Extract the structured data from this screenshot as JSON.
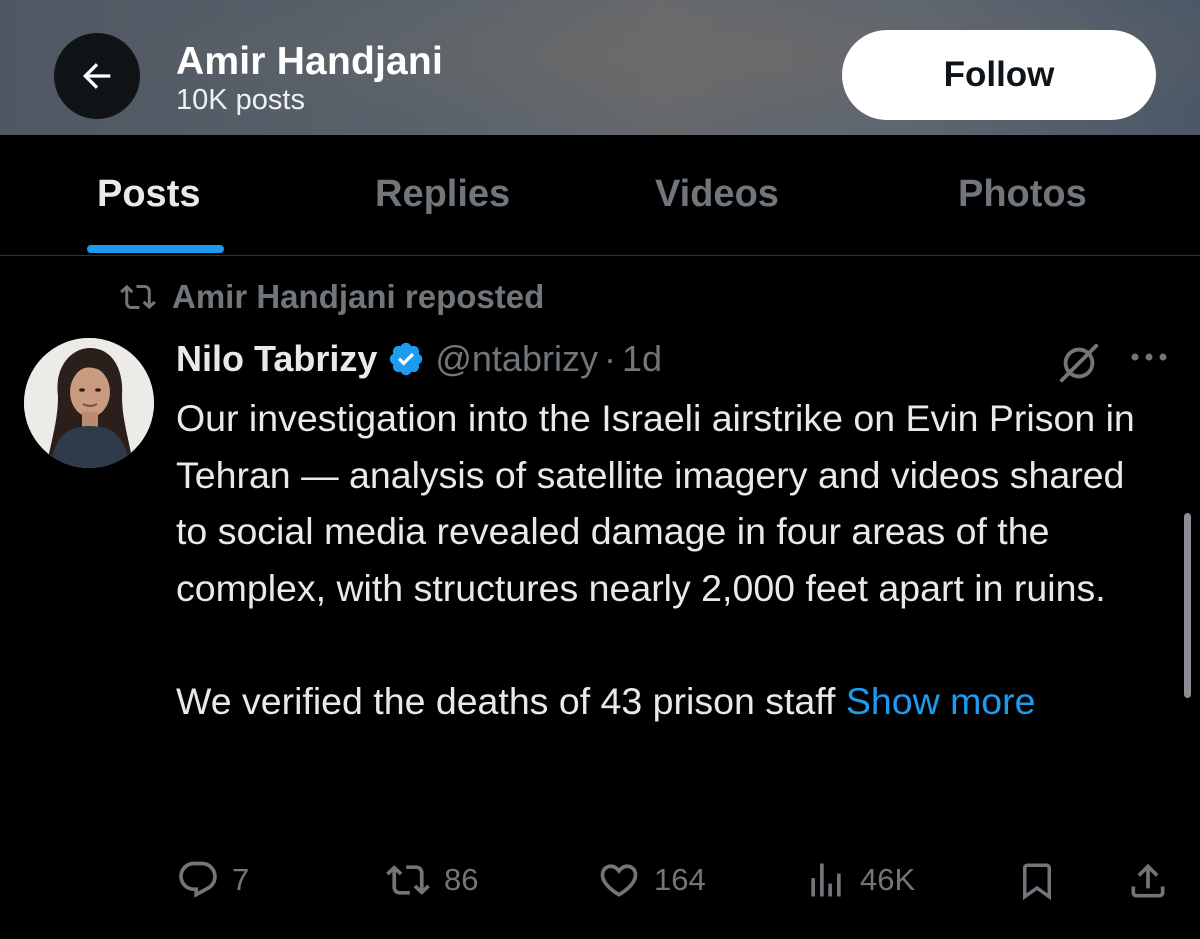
{
  "header": {
    "name": "Amir Handjani",
    "post_count": "10K posts",
    "follow_label": "Follow",
    "back_icon": "arrow-left-icon"
  },
  "tabs": [
    {
      "label": "Posts",
      "active": true
    },
    {
      "label": "Replies",
      "active": false
    },
    {
      "label": "Videos",
      "active": false
    },
    {
      "label": "Photos",
      "active": false
    }
  ],
  "tweet": {
    "repost_label": "Amir Handjani reposted",
    "author_name": "Nilo Tabrizy",
    "handle": "@ntabrizy",
    "separator": "·",
    "time": "1d",
    "body": "Our investigation into the Israeli airstrike on Evin Prison in Tehran — analysis of satellite imagery and videos shared to social media revealed damage in four areas of the complex, with structures nearly 2,000 feet apart in ruins.",
    "body2": "We verified the deaths of 43 prison staff",
    "show_more": "Show more",
    "stats": {
      "replies": "7",
      "reposts": "86",
      "likes": "164",
      "views": "46K"
    }
  },
  "colors": {
    "accent": "#1d9bf0",
    "muted": "#71767b",
    "text": "#e7e9ea",
    "background": "#000000"
  }
}
